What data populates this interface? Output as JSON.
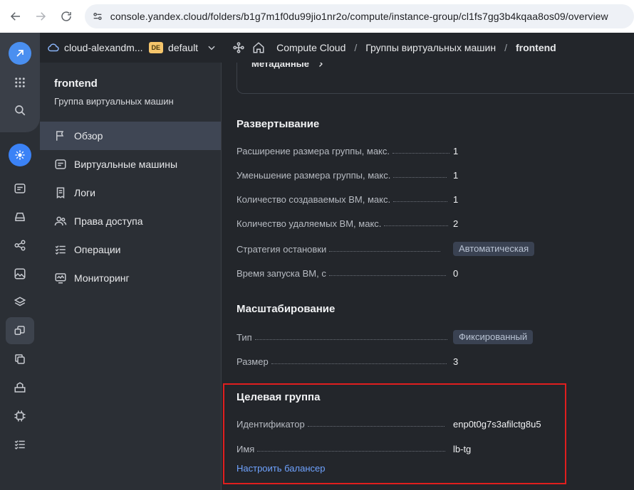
{
  "browser": {
    "url": "console.yandex.cloud/folders/b1g7m1f0du99jio1nr2o/compute/instance-group/cl1fs7gg3b4kqaa8os09/overview"
  },
  "header": {
    "cloud_name": "cloud-alexandm...",
    "org_badge": "DE",
    "folder_name": "default",
    "breadcrumbs": [
      "Compute Cloud",
      "Группы виртуальных машин",
      "frontend"
    ]
  },
  "subnav": {
    "title": "frontend",
    "subtitle": "Группа виртуальных машин",
    "items": [
      {
        "label": "Обзор",
        "icon": "flag-icon",
        "active": true
      },
      {
        "label": "Виртуальные машины",
        "icon": "server-icon"
      },
      {
        "label": "Логи",
        "icon": "logs-icon"
      },
      {
        "label": "Права доступа",
        "icon": "users-icon"
      },
      {
        "label": "Операции",
        "icon": "list-check-icon"
      },
      {
        "label": "Мониторинг",
        "icon": "monitor-icon"
      }
    ]
  },
  "main": {
    "metadata_link": "Метаданные",
    "deployment": {
      "title": "Развертывание",
      "rows": [
        {
          "label": "Расширение размера группы, макс.",
          "value": "1"
        },
        {
          "label": "Уменьшение размера группы, макс.",
          "value": "1"
        },
        {
          "label": "Количество создаваемых ВМ, макс.",
          "value": "1"
        },
        {
          "label": "Количество удаляемых ВМ, макс.",
          "value": "2"
        },
        {
          "label": "Стратегия остановки",
          "value": "Автоматическая"
        },
        {
          "label": "Время запуска ВМ, с",
          "value": "0"
        }
      ]
    },
    "scaling": {
      "title": "Масштабирование",
      "rows": [
        {
          "label": "Тип",
          "value": "Фиксированный"
        },
        {
          "label": "Размер",
          "value": "3"
        }
      ]
    },
    "target_group": {
      "title": "Целевая группа",
      "rows": [
        {
          "label": "Идентификатор",
          "value": "enp0t0g7s3afilctg8u5"
        },
        {
          "label": "Имя",
          "value": "lb-tg"
        }
      ],
      "link": "Настроить балансер"
    }
  },
  "colors": {
    "accent": "#3b82f6",
    "link": "#6fa3ff",
    "highlight": "#e01e1e"
  }
}
